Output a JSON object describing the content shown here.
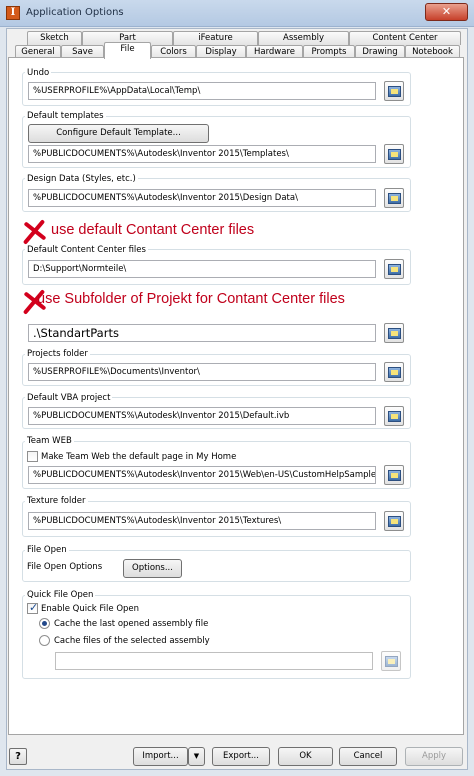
{
  "window": {
    "title": "Application Options",
    "close_glyph": "✕"
  },
  "tabs": {
    "row1": [
      "Sketch",
      "Part",
      "iFeature",
      "Assembly",
      "Content Center"
    ],
    "row2": [
      "General",
      "Save",
      "File",
      "Colors",
      "Display",
      "Hardware",
      "Prompts",
      "Drawing",
      "Notebook"
    ],
    "active": "File"
  },
  "file": {
    "undo": {
      "label": "Undo",
      "path": "%USERPROFILE%\\AppData\\Local\\Temp\\"
    },
    "default_templates": {
      "label": "Default templates",
      "configure_button": "Configure Default Template...",
      "path": "%PUBLICDOCUMENTS%\\Autodesk\\Inventor 2015\\Templates\\"
    },
    "design_data": {
      "label": "Design Data (Styles, etc.)",
      "path": "%PUBLICDOCUMENTS%\\Autodesk\\Inventor 2015\\Design Data\\"
    },
    "annotation1": "use default Contant Center files",
    "content_center": {
      "label": "Default Content Center files",
      "path": "D:\\Support\\Normteile\\"
    },
    "annotation2": "use Subfolder of Projekt for Contant Center files",
    "subfolder_path": ".\\StandartParts",
    "projects": {
      "label": "Projects folder",
      "path": "%USERPROFILE%\\Documents\\Inventor\\"
    },
    "vba": {
      "label": "Default VBA project",
      "path": "%PUBLICDOCUMENTS%\\Autodesk\\Inventor 2015\\Default.ivb"
    },
    "team_web": {
      "label": "Team WEB",
      "checkbox_label": "Make Team Web the default page in My Home",
      "checked": false,
      "path": "%PUBLICDOCUMENTS%\\Autodesk\\Inventor 2015\\Web\\en-US\\CustomHelpSample.htm"
    },
    "texture": {
      "label": "Texture folder",
      "path": "%PUBLICDOCUMENTS%\\Autodesk\\Inventor 2015\\Textures\\"
    },
    "file_open": {
      "label": "File Open",
      "options_label": "File Open Options",
      "options_button": "Options..."
    },
    "quick_open": {
      "label": "Quick File Open",
      "enable_label": "Enable Quick File Open",
      "enable_checked": true,
      "radio1": "Cache the last opened assembly file",
      "radio2": "Cache files of the selected assembly",
      "selected": "radio1",
      "path": ""
    }
  },
  "footer": {
    "help": "?",
    "import": "Import...",
    "import_arrow": "▼",
    "export": "Export...",
    "ok": "OK",
    "cancel": "Cancel",
    "apply": "Apply"
  }
}
